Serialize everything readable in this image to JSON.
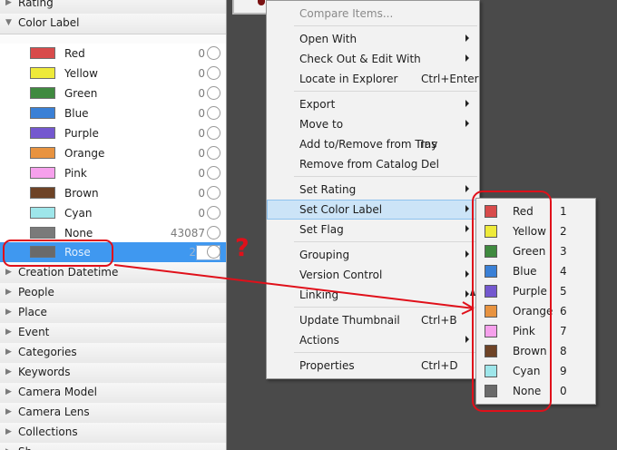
{
  "panel": {
    "sections_top": [
      {
        "label": "Rating",
        "expanded": false
      },
      {
        "label": "Color Label",
        "expanded": true
      }
    ],
    "color_labels": [
      {
        "label": "Red",
        "count": "0",
        "color": "#d84b4b"
      },
      {
        "label": "Yellow",
        "count": "0",
        "color": "#eeea3a"
      },
      {
        "label": "Green",
        "count": "0",
        "color": "#3f8a3f"
      },
      {
        "label": "Blue",
        "count": "0",
        "color": "#3a80d6"
      },
      {
        "label": "Purple",
        "count": "0",
        "color": "#7458cf"
      },
      {
        "label": "Orange",
        "count": "0",
        "color": "#e89340"
      },
      {
        "label": "Pink",
        "count": "0",
        "color": "#f6a0ec"
      },
      {
        "label": "Brown",
        "count": "0",
        "color": "#6e4326"
      },
      {
        "label": "Cyan",
        "count": "0",
        "color": "#9ee6ea"
      },
      {
        "label": "None",
        "count": "43087",
        "color": "#7a7a7a"
      }
    ],
    "selected_label": {
      "label": "Rose",
      "count": "2",
      "color": "#6a6a6a"
    },
    "sections_bottom": [
      {
        "label": "Creation Datetime"
      },
      {
        "label": "People"
      },
      {
        "label": "Place"
      },
      {
        "label": "Event"
      },
      {
        "label": "Categories"
      },
      {
        "label": "Keywords"
      },
      {
        "label": "Camera Model"
      },
      {
        "label": "Camera Lens"
      },
      {
        "label": "Collections"
      },
      {
        "label": "Sh..."
      }
    ]
  },
  "context_menu": {
    "items": [
      {
        "label": "Compare Items...",
        "disabled": true
      },
      {
        "separator": true
      },
      {
        "label": "Open With",
        "submenu": true
      },
      {
        "label": "Check Out & Edit With",
        "submenu": true
      },
      {
        "label": "Locate in Explorer",
        "shortcut": "Ctrl+Enter"
      },
      {
        "separator": true
      },
      {
        "label": "Export",
        "submenu": true
      },
      {
        "label": "Move to",
        "submenu": true
      },
      {
        "label": "Add to/Remove from Tray",
        "shortcut": "Ins"
      },
      {
        "label": "Remove from Catalog",
        "shortcut": "Del"
      },
      {
        "separator": true
      },
      {
        "label": "Set Rating",
        "submenu": true
      },
      {
        "label": "Set Color Label",
        "submenu": true,
        "highlighted": true
      },
      {
        "label": "Set Flag",
        "submenu": true
      },
      {
        "separator": true
      },
      {
        "label": "Grouping",
        "submenu": true
      },
      {
        "label": "Version Control",
        "submenu": true
      },
      {
        "label": "Linking",
        "submenu": true
      },
      {
        "separator": true
      },
      {
        "label": "Update Thumbnail",
        "shortcut": "Ctrl+B"
      },
      {
        "label": "Actions",
        "submenu": true
      },
      {
        "separator": true
      },
      {
        "label": "Properties",
        "shortcut": "Ctrl+D"
      }
    ]
  },
  "color_submenu": [
    {
      "label": "Red",
      "key": "1",
      "color": "#d84b4b"
    },
    {
      "label": "Yellow",
      "key": "2",
      "color": "#eeea3a"
    },
    {
      "label": "Green",
      "key": "3",
      "color": "#3f8a3f"
    },
    {
      "label": "Blue",
      "key": "4",
      "color": "#3a80d6"
    },
    {
      "label": "Purple",
      "key": "5",
      "color": "#7458cf"
    },
    {
      "label": "Orange",
      "key": "6",
      "color": "#e89340"
    },
    {
      "label": "Pink",
      "key": "7",
      "color": "#f6a0ec"
    },
    {
      "label": "Brown",
      "key": "8",
      "color": "#6e4326"
    },
    {
      "label": "Cyan",
      "key": "9",
      "color": "#9ee6ea"
    },
    {
      "label": "None",
      "key": "0",
      "color": "#6a6a6a"
    }
  ],
  "annotation": {
    "mark": "?",
    "color": "#e0101a"
  }
}
